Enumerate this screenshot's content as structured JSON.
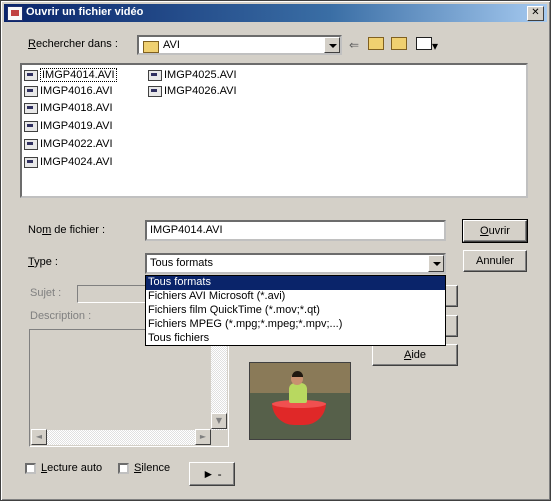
{
  "window": {
    "title": "Ouvrir un fichier vidéo",
    "close_glyph": "✕"
  },
  "lookin": {
    "label_pre": "",
    "label_u": "R",
    "label_post": "echercher dans :",
    "value": "AVI"
  },
  "toolbar": {
    "back_icon": "back-arrow-icon",
    "up_icon": "up-folder-icon",
    "new_icon": "new-folder-icon",
    "view_icon": "view-menu-icon"
  },
  "files": [
    {
      "name": "IMGP4014.AVI",
      "selected": true
    },
    {
      "name": "IMGP4016.AVI"
    },
    {
      "name": "IMGP4018.AVI"
    },
    {
      "name": "IMGP4019.AVI"
    },
    {
      "name": "IMGP4022.AVI"
    },
    {
      "name": "IMGP4024.AVI"
    },
    {
      "name": "IMGP4025.AVI"
    },
    {
      "name": "IMGP4026.AVI"
    }
  ],
  "filename": {
    "label_pre": "No",
    "label_u": "m",
    "label_post": " de fichier :",
    "value": "IMGP4014.AVI"
  },
  "type": {
    "label_pre": "",
    "label_u": "T",
    "label_post": "ype :",
    "value": "Tous formats"
  },
  "type_options": [
    "Tous formats",
    "Fichiers AVI Microsoft (*.avi)",
    "Fichiers film QuickTime (*.mov;*.qt)",
    "Fichiers MPEG (*.mpg;*.mpeg;*.mpv;...)",
    "Tous fichiers"
  ],
  "buttons": {
    "open_u": "O",
    "open_post": "uvrir",
    "cancel": "Annuler",
    "help_u": "A",
    "help_post": "ide",
    "play": "► -"
  },
  "subject": {
    "label": "Sujet :"
  },
  "description": {
    "label": "Description :"
  },
  "options": {
    "autoplay_u": "L",
    "autoplay_post": "ecture auto",
    "silence_u": "S",
    "silence_post": "ilence"
  }
}
